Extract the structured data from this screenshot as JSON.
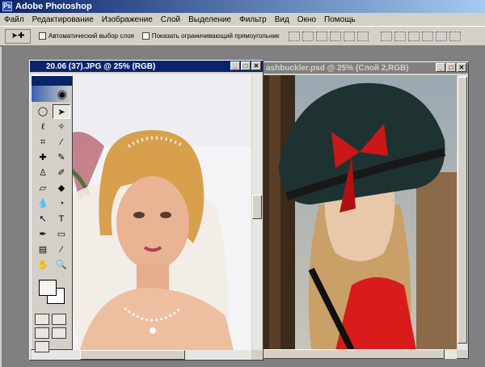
{
  "app": {
    "title": "Adobe Photoshop"
  },
  "menu": [
    "Файл",
    "Редактирование",
    "Изображение",
    "Слой",
    "Выделение",
    "Фильтр",
    "Вид",
    "Окно",
    "Помощь"
  ],
  "options": {
    "auto_select": "Автоматический выбор слоя",
    "show_bounding": "Показать ограничивающий прямоугольник"
  },
  "documents": [
    {
      "title": "20.06 (37).JPG @ 25% (RGB)"
    },
    {
      "title": "ashbuckler.psd @ 25% (Слой 2,RGB)"
    }
  ],
  "colors": {
    "titlebar": "#0a246a",
    "chrome": "#d4d0c8",
    "workspace": "#808080"
  }
}
